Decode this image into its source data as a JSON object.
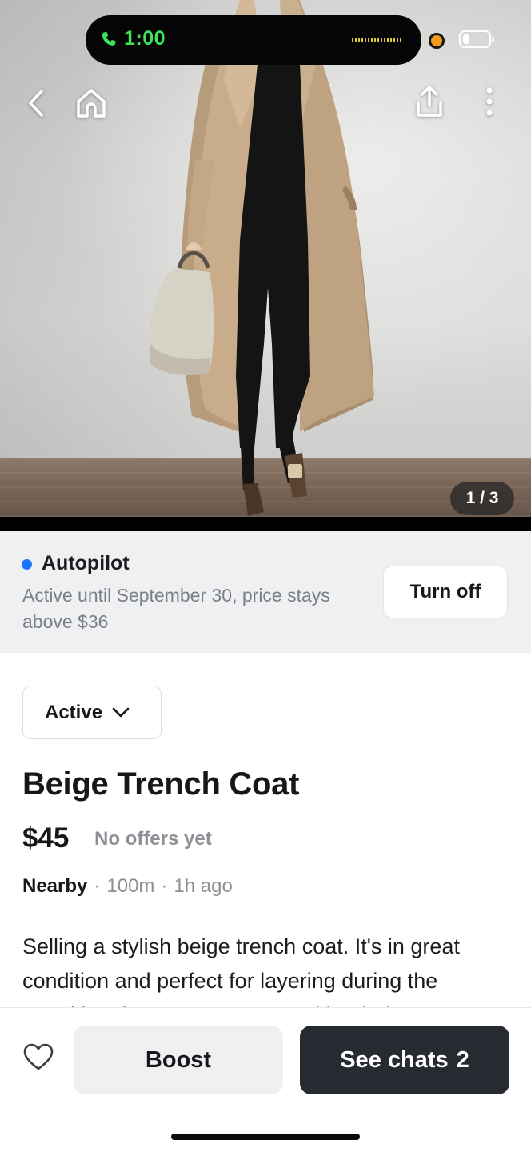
{
  "status_bar": {
    "call_time": "1:00",
    "call_color": "#3ee35a",
    "recording_dot_color": "#f39a1b"
  },
  "photo": {
    "counter": "1 / 3",
    "icons": [
      "back-icon",
      "home-icon",
      "share-icon",
      "more-icon"
    ]
  },
  "autopilot": {
    "dot_color": "#1a73ff",
    "title": "Autopilot",
    "description": "Active until September 30, price stays above $36",
    "turn_off_label": "Turn off"
  },
  "listing": {
    "status": "Active",
    "title": "Beige Trench Coat",
    "price": "$45",
    "offers": "No offers yet",
    "location": "Nearby",
    "separator": "·",
    "distance": "100m",
    "posted": "1h ago",
    "description": "Selling a stylish beige trench coat. It's in great condition and perfect for layering during the transitional seasons. Comes with a belt."
  },
  "bottom_bar": {
    "boost_label": "Boost",
    "chats_label": "See chats",
    "chats_count": "2"
  }
}
